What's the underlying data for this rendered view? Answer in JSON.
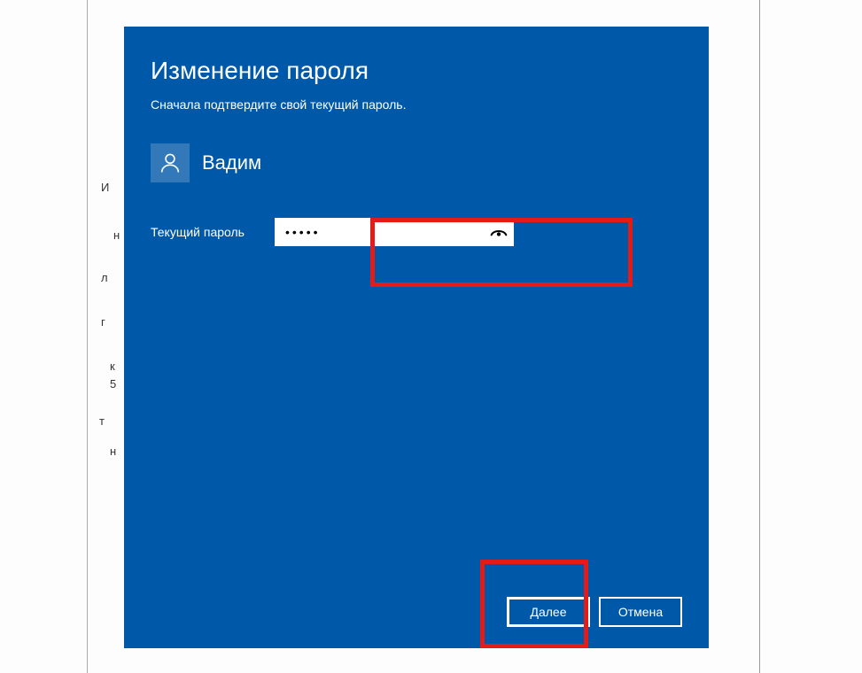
{
  "dialog": {
    "title": "Изменение пароля",
    "subtitle": "Сначала подтвердите свой текущий пароль."
  },
  "user": {
    "name": "Вадим"
  },
  "field": {
    "label": "Текущий пароль",
    "value": "•••••"
  },
  "buttons": {
    "next": "Далее",
    "cancel": "Отмена"
  },
  "bg_fragments": {
    "a": "И",
    "b": "н",
    "c": "л",
    "d": "г",
    "e": "к",
    "f": "5",
    "g": "т",
    "h": "н"
  }
}
